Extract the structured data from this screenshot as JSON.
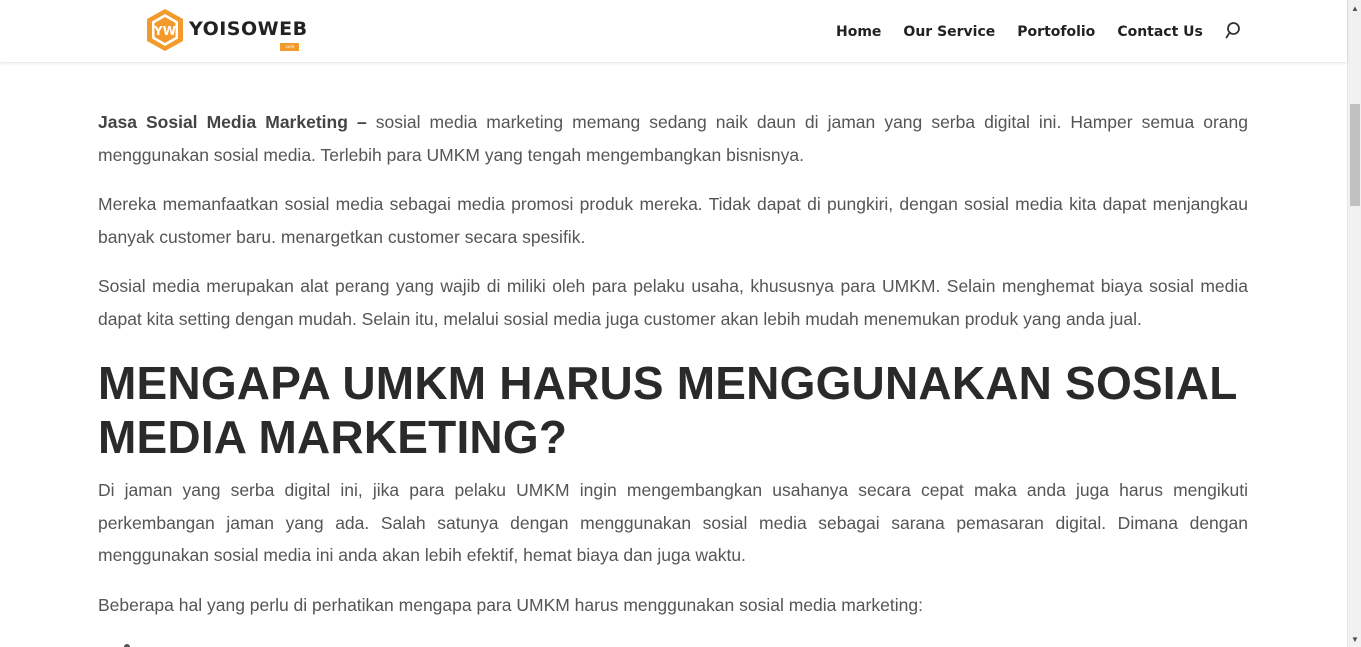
{
  "brand": {
    "name": "YOISOWEB",
    "sub": ".com",
    "accent_color": "#f39a2c"
  },
  "nav": {
    "items": [
      {
        "label": "Home"
      },
      {
        "label": "Our Service"
      },
      {
        "label": "Portofolio"
      },
      {
        "label": "Contact Us"
      }
    ],
    "search_icon": "search-icon"
  },
  "article": {
    "intro_bold": "Jasa Sosial Media Marketing –",
    "intro_rest": " sosial media marketing memang sedang naik daun di jaman yang serba digital ini. Hamper semua orang menggunakan sosial media. Terlebih para UMKM yang tengah mengembangkan bisnisnya.",
    "p2": "Mereka memanfaatkan sosial media sebagai media promosi produk mereka. Tidak dapat di pungkiri, dengan sosial media kita dapat menjangkau banyak customer baru. menargetkan customer secara spesifik.",
    "p3": "Sosial media merupakan alat perang yang wajib di miliki oleh para pelaku usaha, khususnya para UMKM. Selain menghemat biaya sosial media dapat kita setting dengan mudah. Selain itu, melalui sosial media juga customer akan lebih mudah menemukan produk yang anda jual.",
    "heading": "MENGAPA UMKM HARUS MENGGUNAKAN SOSIAL MEDIA MARKETING?",
    "p4": "Di jaman yang serba digital ini, jika para pelaku UMKM ingin mengembangkan usahanya secara cepat maka anda juga harus mengikuti perkembangan jaman yang ada. Salah satunya dengan menggunakan sosial media sebagai sarana pemasaran digital. Dimana dengan menggunakan sosial media ini anda akan lebih efektif, hemat biaya dan juga waktu.",
    "p5": "Beberapa hal yang perlu di perhatikan mengapa para UMKM harus menggunakan sosial media marketing:"
  },
  "scrollbar": {
    "up_icon": "chevron-up-icon",
    "down_icon": "chevron-down-icon"
  }
}
